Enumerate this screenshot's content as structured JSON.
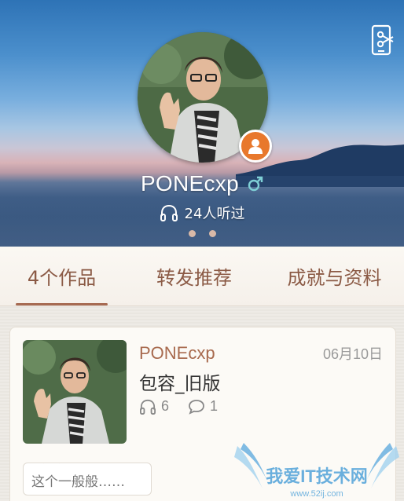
{
  "profile": {
    "username": "PONEcxp",
    "gender": "male",
    "listener_text": "24人听过",
    "carousel_dots": 2
  },
  "tabs": [
    {
      "label": "4个作品",
      "active": true
    },
    {
      "label": "转发推荐",
      "active": false
    },
    {
      "label": "成就与资料",
      "active": false
    }
  ],
  "works": [
    {
      "author": "PONEcxp",
      "date": "06月10日",
      "title": "包容_旧版",
      "listens": "6",
      "comments": "1",
      "comment_preview": "这个一般般……"
    }
  ],
  "watermark": {
    "text": "我爱IT技术网",
    "domain": "www.52ij.com"
  },
  "colors": {
    "accent": "#a86a4e",
    "badge": "#e8782c",
    "gender": "#7fd0d6"
  },
  "icons": [
    "scissors-phone-icon",
    "user-badge-icon",
    "male-icon",
    "headphones-icon",
    "comment-icon"
  ]
}
